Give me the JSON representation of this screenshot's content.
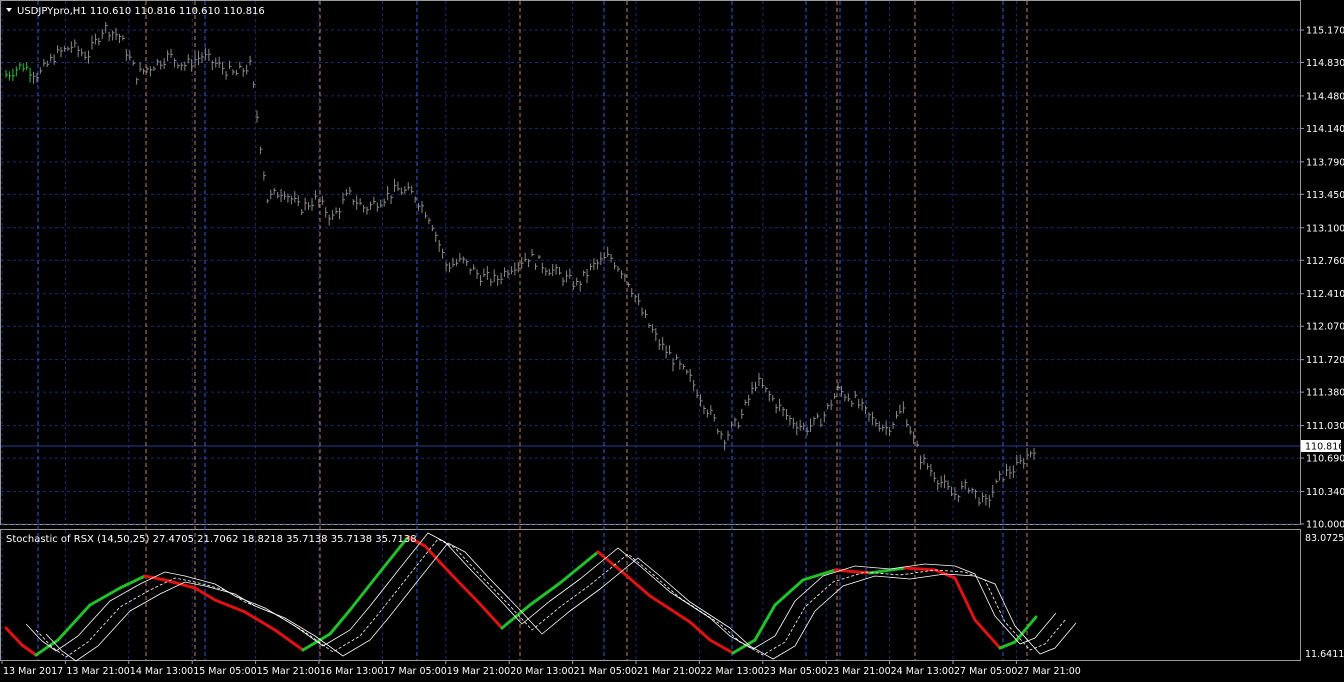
{
  "main_chart": {
    "symbol_header": "USDJPYpro,H1  110.610 110.816 110.610 110.816",
    "price_axis_labels": [
      "115.170",
      "114.830",
      "114.480",
      "114.140",
      "113.790",
      "113.450",
      "113.100",
      "112.760",
      "112.410",
      "112.070",
      "111.720",
      "111.380",
      "111.030",
      "110.690",
      "110.340",
      "110.000"
    ],
    "current_price": "110.816",
    "price_range": [
      110.0,
      115.17
    ],
    "ohlc_path_prices": [
      114.7,
      114.8,
      114.7,
      114.9,
      115.0,
      114.9,
      115.2,
      115.1,
      114.7,
      114.8,
      114.9,
      114.8,
      114.9,
      114.8,
      114.7,
      114.8,
      113.4,
      113.5,
      113.3,
      113.4,
      113.2,
      113.45,
      113.3,
      113.4,
      113.5,
      113.45,
      113.2,
      112.7,
      112.75,
      112.6,
      112.55,
      112.7,
      112.8,
      112.7,
      112.6,
      112.5,
      112.7,
      112.8,
      112.6,
      112.2,
      111.9,
      111.7,
      111.5,
      111.2,
      110.9,
      111.1,
      111.5,
      111.3,
      111.1,
      111.0,
      111.1,
      111.4,
      111.3,
      111.1,
      111.0,
      111.2,
      110.7,
      110.5,
      110.3,
      110.4,
      110.2,
      110.5,
      110.6,
      110.8
    ],
    "colors": {
      "background": "#000000",
      "grid": "#1d2a6e",
      "bar": "#8a8a8a",
      "first_bars": "#2fbf3a",
      "period_separator": "#3a5bd8",
      "session_separator": "#c08060",
      "price_line": "#2a3d8f"
    }
  },
  "indicator": {
    "header": "Stochastic of RSX (14,50,25) 27.4705 21.7062 18.8218 35.7138 35.7138 35.7138",
    "axis_top": "83.0725",
    "axis_bottom": "11.6411",
    "colors": {
      "up": "#22c02a",
      "down": "#e01212",
      "band": "#ffffff"
    }
  },
  "time_axis_labels": [
    "13 Mar 2017",
    "13 Mar 21:00",
    "14 Mar 13:00",
    "15 Mar 05:00",
    "15 Mar 21:00",
    "16 Mar 13:00",
    "17 Mar 05:00",
    "19 Mar 21:00",
    "20 Mar 13:00",
    "21 Mar 05:00",
    "21 Mar 21:00",
    "22 Mar 13:00",
    "23 Mar 05:00",
    "23 Mar 21:00",
    "24 Mar 13:00",
    "27 Mar 05:00",
    "27 Mar 21:00"
  ]
}
